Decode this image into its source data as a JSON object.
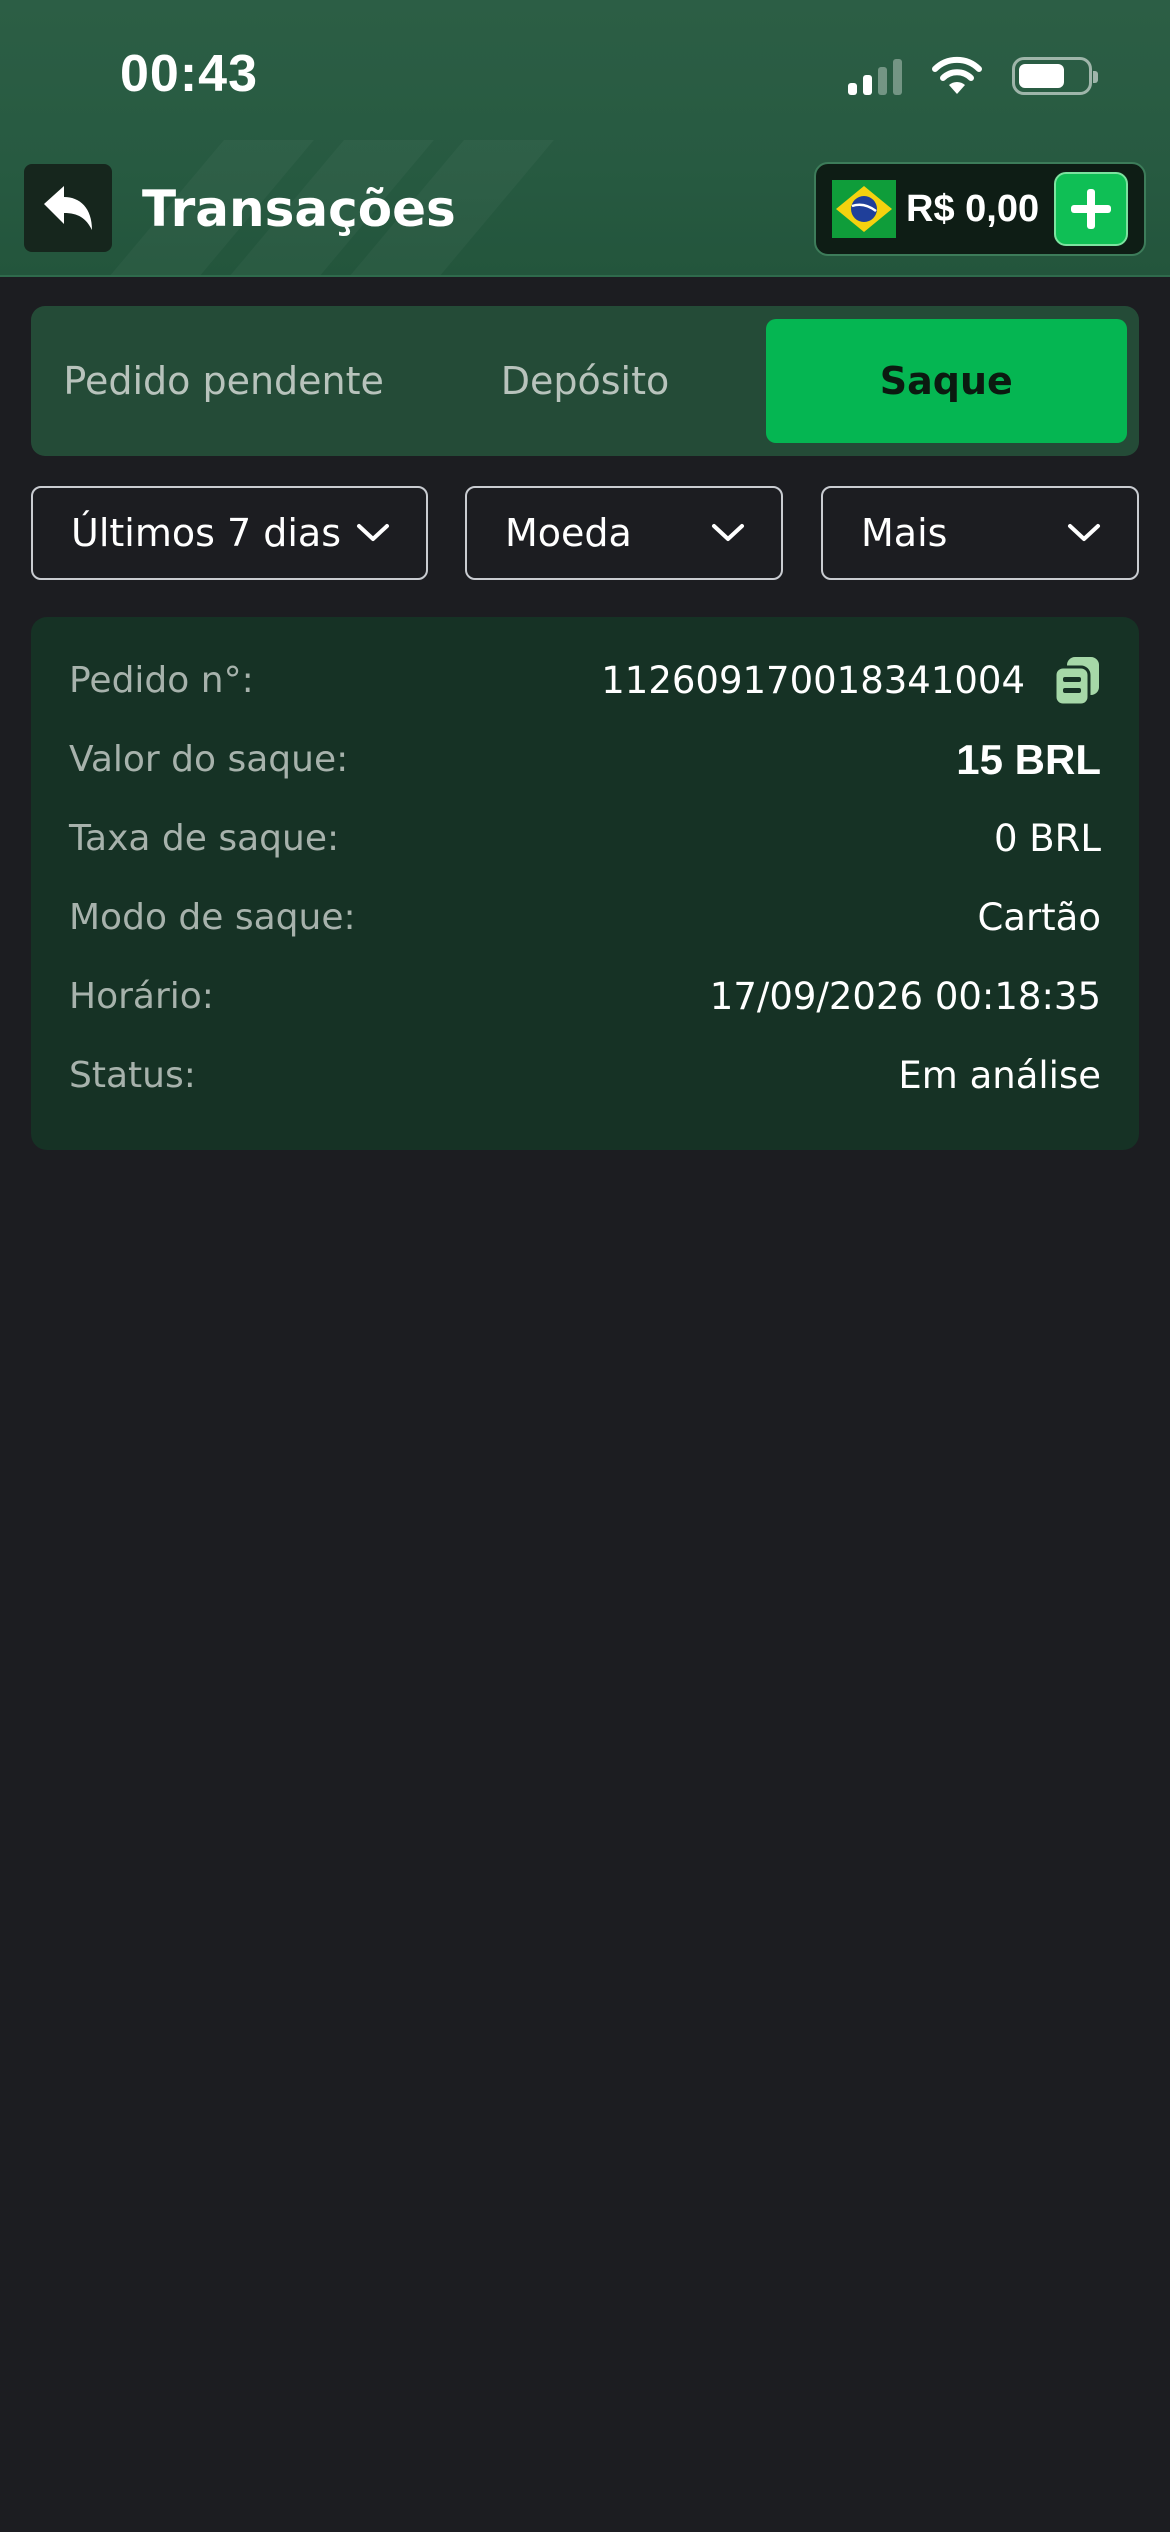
{
  "status_bar": {
    "time": "00:43"
  },
  "header": {
    "title": "Transações",
    "balance": "R$ 0,00",
    "flag_icon": "brazil-flag-icon",
    "colors": {
      "header_bg": "#2a5c43",
      "add_button": "#0fbf55"
    }
  },
  "tabs": [
    {
      "label": "Pedido pendente",
      "active": false
    },
    {
      "label": "Depósito",
      "active": false
    },
    {
      "label": "Saque",
      "active": true
    }
  ],
  "filters": {
    "period": "Últimos 7 dias",
    "currency": "Moeda",
    "more": "Mais"
  },
  "transaction": {
    "order_no_label": "Pedido n°:",
    "order_no": "112609170018341004",
    "amount_label": "Valor do saque:",
    "amount": "15 BRL",
    "fee_label": "Taxa de saque:",
    "fee": "0 BRL",
    "mode_label": "Modo de saque:",
    "mode": "Cartão",
    "time_label": "Horário:",
    "time": "17/09/2026 00:18:35",
    "status_label": "Status:",
    "status": "Em análise"
  },
  "colors": {
    "page_bg": "#1c1d21",
    "active_tab": "#05b652",
    "card_bg": "#163225"
  }
}
